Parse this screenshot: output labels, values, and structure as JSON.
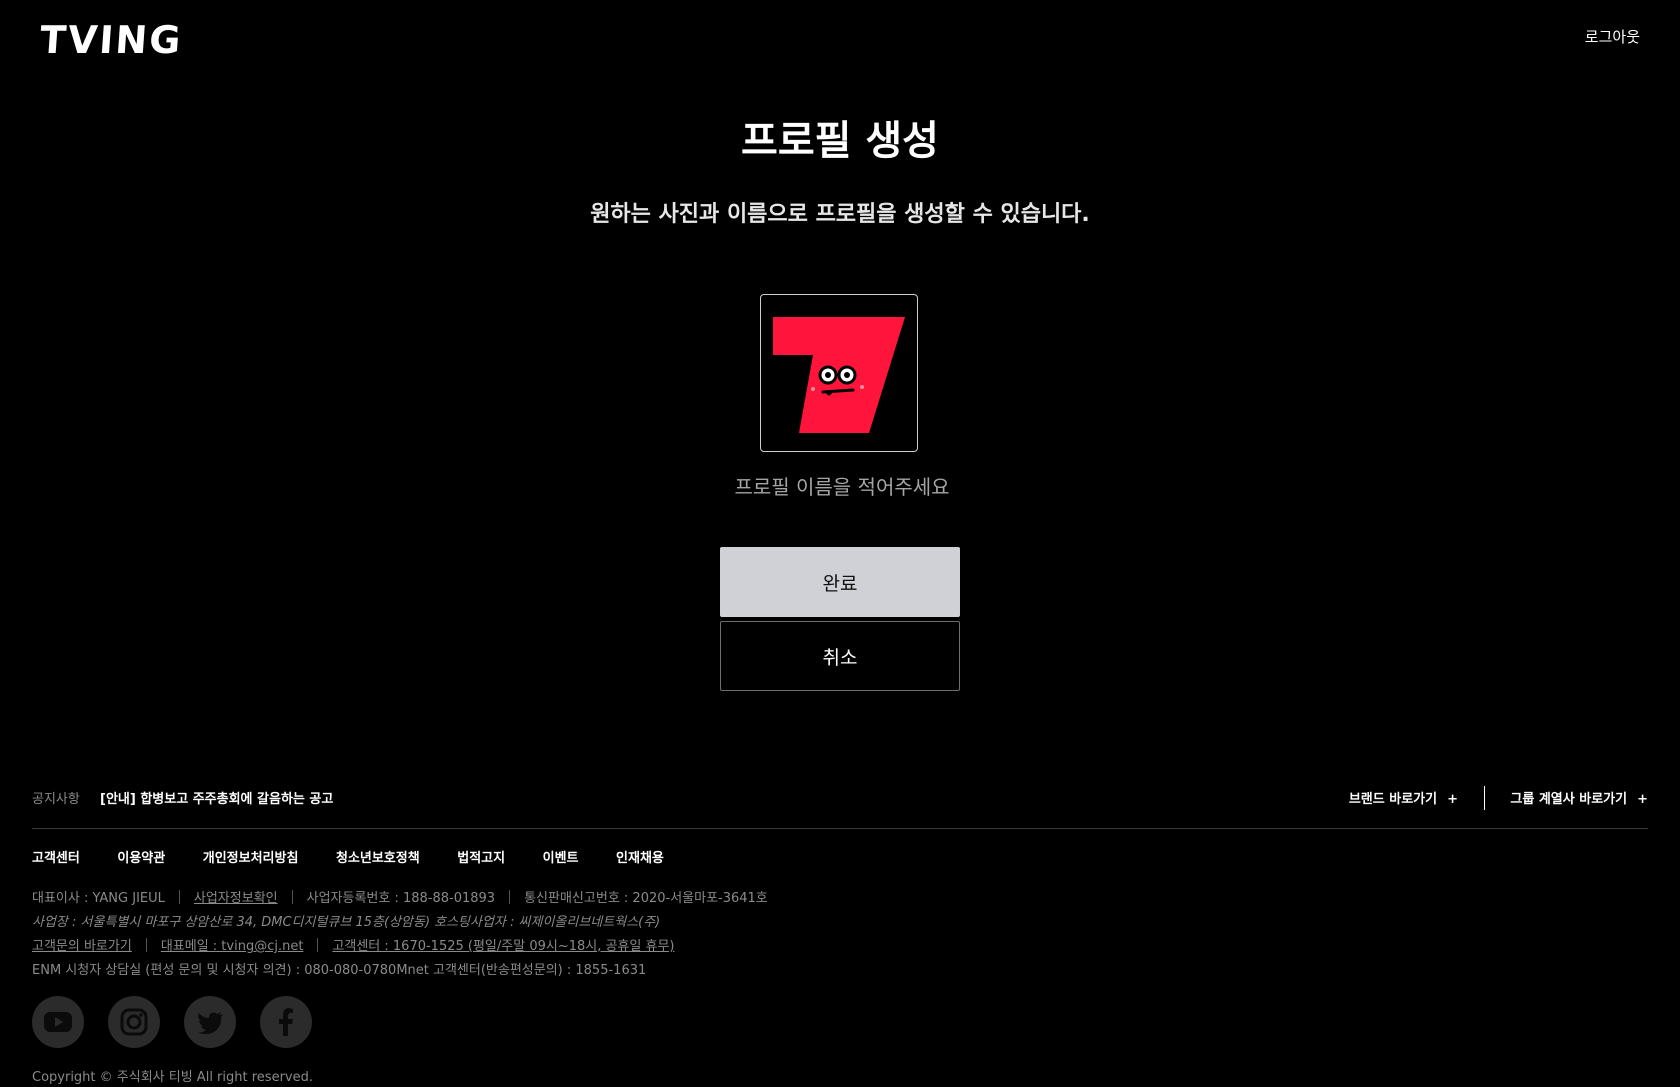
{
  "header": {
    "logo": "TVING",
    "logout_label": "로그아웃"
  },
  "main": {
    "title": "프로필 생성",
    "subtitle": "원하는 사진과 이름으로 프로필을 생성할 수 있습니다.",
    "name_placeholder": "프로필 이름을 적어주세요",
    "done_label": "완료",
    "cancel_label": "취소"
  },
  "colors": {
    "accent": "#ff153c",
    "background": "#000000",
    "button_done_bg": "#cfd1d6"
  },
  "footer": {
    "notice_label": "공지사항",
    "notice_text": "[안내] 합병보고 주주총회에 갈음하는 공고",
    "brand_shortcut": "브랜드 바로가기",
    "group_shortcut": "그룹 계열사 바로가기",
    "plus_icon": "+",
    "links": [
      "고객센터",
      "이용약관",
      "개인정보처리방침",
      "청소년보호정책",
      "법적고지",
      "이벤트",
      "인재채용"
    ],
    "info": {
      "ceo": "대표이사 : YANG JIEUL",
      "business_info": "사업자정보확인",
      "business_number": "사업자등록번호 : 188-88-01893",
      "ecommerce_number": "통신판매신고번호 : 2020-서울마포-3641호",
      "address": "사업장 : 서울특별시 마포구 상암산로 34, DMC디지털큐브 15층(상암동) 호스팅사업자 : 씨제이올리브네트웍스(주)",
      "inquiry": "고객문의 바로가기",
      "email": "대표메일 : tving@cj.net",
      "cs_center": "고객센터 : 1670-1525 (평일/주말 09시~18시, 공휴일 휴무)",
      "enm": "ENM 시청자 상담실 (편성 문의 및 시청자 의견) : 080-080-0780Mnet 고객센터(반송편성문의) : 1855-1631"
    },
    "socials": [
      "youtube-icon",
      "instagram-icon",
      "twitter-icon",
      "facebook-icon"
    ],
    "copyright": "Copyright © 주식회사 티빙 All right reserved."
  }
}
